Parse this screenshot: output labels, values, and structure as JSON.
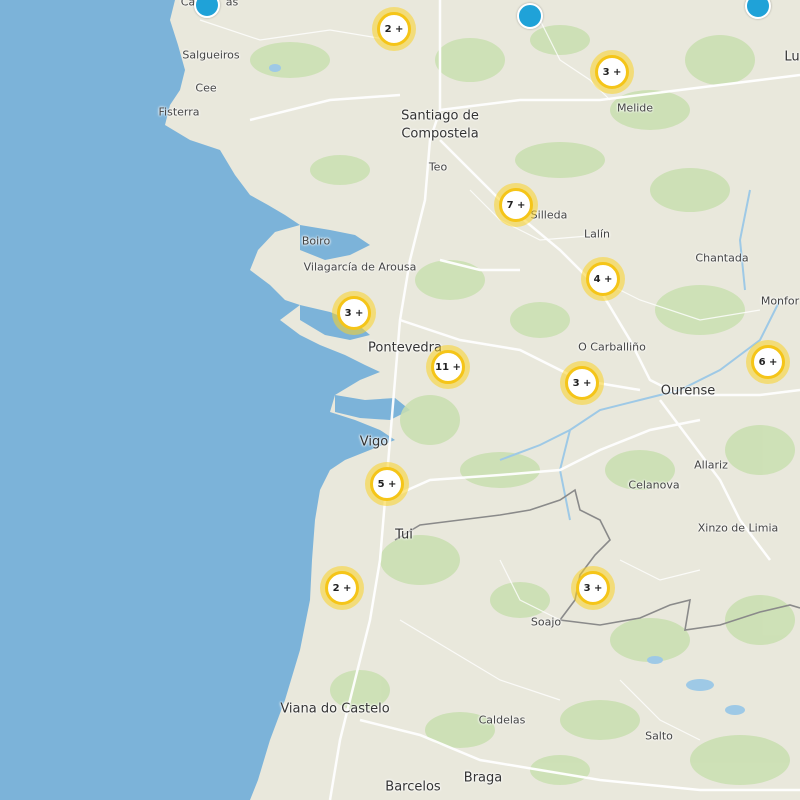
{
  "map": {
    "colors": {
      "sea": "#7cb3d9",
      "land": "#e9e8dc",
      "forest": "#c9dfb0",
      "road": "#ffffff",
      "border": "#8a8a8a",
      "cluster": "#f5c518",
      "pin": "#1fa2d8"
    },
    "places": [
      {
        "name": "Ca",
        "kind": "small"
      },
      {
        "name": "as",
        "kind": "small"
      },
      {
        "name": "Salgueiros",
        "kind": "small"
      },
      {
        "name": "Cee",
        "kind": "small"
      },
      {
        "name": "Fisterra",
        "kind": "small"
      },
      {
        "name": "Santiago de",
        "kind": "city"
      },
      {
        "name": "Compostela",
        "kind": "city"
      },
      {
        "name": "Teo",
        "kind": "small"
      },
      {
        "name": "Melide",
        "kind": "small"
      },
      {
        "name": "Lu",
        "kind": "city"
      },
      {
        "name": "Silleda",
        "kind": "small"
      },
      {
        "name": "Lalín",
        "kind": "small"
      },
      {
        "name": "Chantada",
        "kind": "small"
      },
      {
        "name": "Boiro",
        "kind": "small"
      },
      {
        "name": "Vilagarcía de Arousa",
        "kind": "small"
      },
      {
        "name": "Monfor",
        "kind": "small"
      },
      {
        "name": "Pontevedra",
        "kind": "city"
      },
      {
        "name": "O Carballiño",
        "kind": "small"
      },
      {
        "name": "Ourense",
        "kind": "city"
      },
      {
        "name": "Vigo",
        "kind": "city"
      },
      {
        "name": "Allariz",
        "kind": "small"
      },
      {
        "name": "Celanova",
        "kind": "small"
      },
      {
        "name": "Xinzo de Limia",
        "kind": "small"
      },
      {
        "name": "Tui",
        "kind": "city"
      },
      {
        "name": "Soajo",
        "kind": "small"
      },
      {
        "name": "Viana do Castelo",
        "kind": "city"
      },
      {
        "name": "Caldelas",
        "kind": "small"
      },
      {
        "name": "Salto",
        "kind": "small"
      },
      {
        "name": "Barcelos",
        "kind": "city"
      },
      {
        "name": "Braga",
        "kind": "city"
      }
    ],
    "clusters": [
      {
        "label": "2 +"
      },
      {
        "label": "3 +"
      },
      {
        "label": "7 +"
      },
      {
        "label": "4 +"
      },
      {
        "label": "3 +"
      },
      {
        "label": "11 +"
      },
      {
        "label": "3 +"
      },
      {
        "label": "6 +"
      },
      {
        "label": "5 +"
      },
      {
        "label": "2 +"
      },
      {
        "label": "3 +"
      }
    ],
    "pins": [
      "pin",
      "pin",
      "pin"
    ]
  }
}
